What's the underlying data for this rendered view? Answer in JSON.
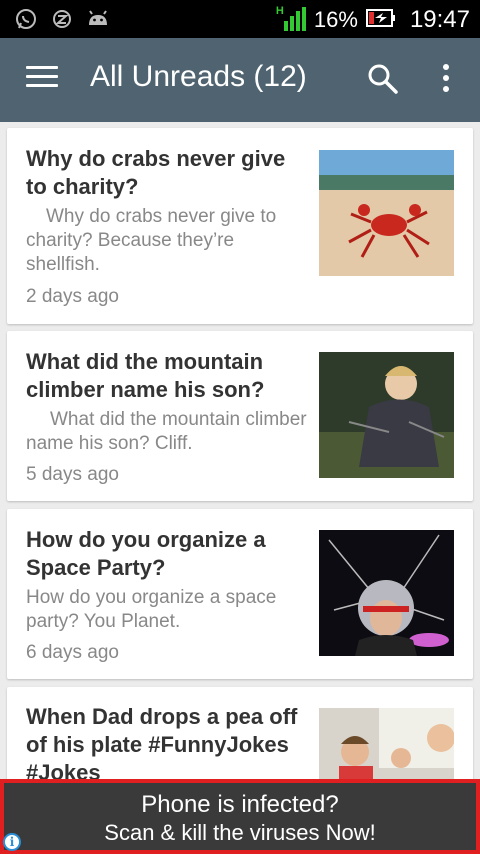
{
  "status_bar": {
    "left_icons": [
      "whatsapp-icon",
      "z-app-icon",
      "android-icon"
    ],
    "signal_label": "H",
    "battery_percent": "16%",
    "time": "19:47"
  },
  "app_bar": {
    "title": "All Unreads (12)",
    "menu_icon": "hamburger-menu-icon",
    "search_icon": "search-icon",
    "more_icon": "more-vert-icon",
    "color": "#4f6470"
  },
  "feed": [
    {
      "title": "Why do crabs never give to charity?",
      "excerpt": "Why do crabs never give to charity? Because they’re shellfish.",
      "time": "2 days ago"
    },
    {
      "title": "What did the mountain climber name his son?",
      "excerpt": "What did the mountain climber name his son? Cliff.",
      "time": "5 days ago"
    },
    {
      "title": "How do you organize a Space Party?",
      "excerpt": "How do you organize a space party? You Planet.",
      "time": "6 days ago"
    },
    {
      "title": "When Dad drops a pea off of his plate #FunnyJokes #Jokes"
    }
  ],
  "ad": {
    "line1": "Phone is infected?",
    "line2": "Scan & kill the viruses Now!",
    "info_icon": "ad-info-icon",
    "border_color": "#e02020"
  }
}
